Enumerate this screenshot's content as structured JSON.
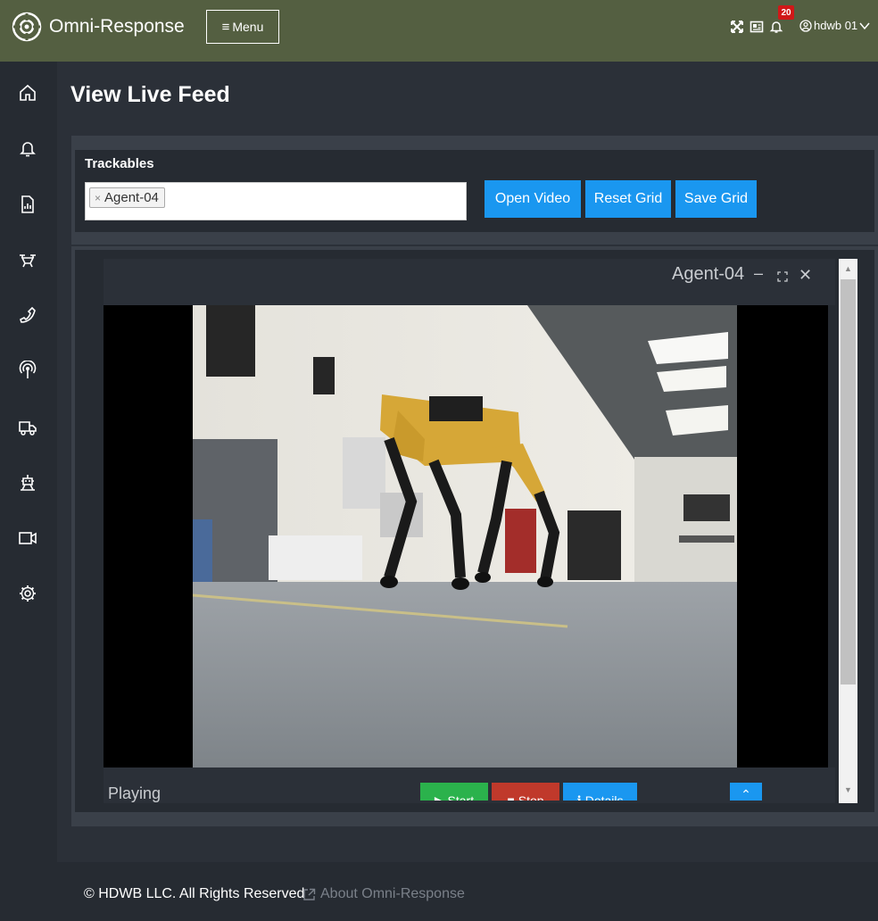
{
  "app": {
    "brand": "Omni-Response",
    "menu_label": "Menu"
  },
  "topbar": {
    "notification_count": "20",
    "user_name": "hdwb 01"
  },
  "sidebar": {
    "items": [
      {
        "icon": "home-icon"
      },
      {
        "icon": "bell-icon"
      },
      {
        "icon": "report-icon"
      },
      {
        "icon": "drone-icon"
      },
      {
        "icon": "phone-icon"
      },
      {
        "icon": "sensor-icon"
      },
      {
        "icon": "truck-icon"
      },
      {
        "icon": "robot-icon"
      },
      {
        "icon": "video-camera-icon"
      },
      {
        "icon": "gear-icon"
      }
    ]
  },
  "page": {
    "title": "View Live Feed"
  },
  "trackables": {
    "label": "Trackables",
    "selected_tag": "Agent-04",
    "buttons": {
      "open_video": "Open Video",
      "reset_grid": "Reset Grid",
      "save_grid": "Save Grid"
    }
  },
  "video_panel": {
    "title": "Agent-04",
    "status": "Playing",
    "controls": {
      "start": "Start",
      "stop": "Stop",
      "details": "Details"
    }
  },
  "footer": {
    "copyright": "© HDWB LLC. All Rights Reserved",
    "about_link": "About Omni-Response"
  },
  "colors": {
    "topbar": "#545f41",
    "accent_blue": "#1a97f0",
    "start_green": "#2bb24c",
    "stop_red": "#c0392b",
    "badge_red": "#d01818"
  }
}
